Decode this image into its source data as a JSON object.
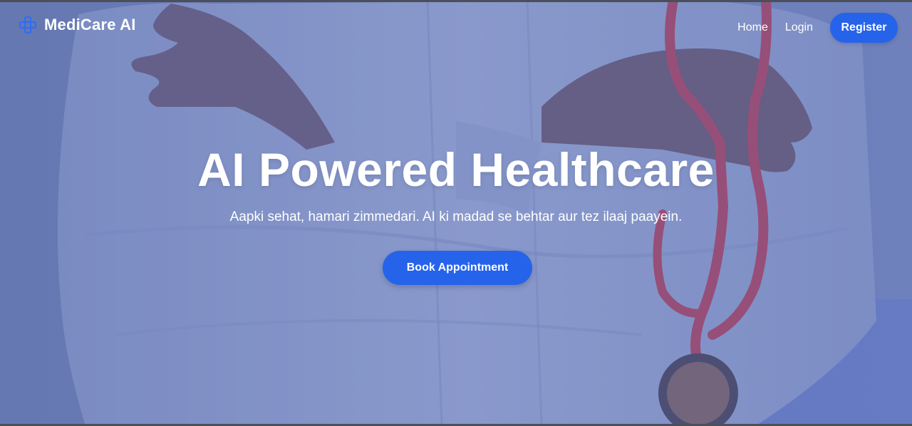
{
  "brand": {
    "name": "MediCare AI",
    "icon": "medical-cross-icon",
    "icon_color": "#2f6df2"
  },
  "nav": {
    "home_label": "Home",
    "login_label": "Login",
    "register_label": "Register"
  },
  "hero": {
    "title": "AI Powered Healthcare",
    "subtitle": "Aapki sehat, hamari zimmedari. AI ki madad se behtar aur tez ilaaj paayein.",
    "cta_label": "Book Appointment"
  },
  "colors": {
    "accent": "#2563eb",
    "overlay": "#7386bd",
    "text": "#ffffff"
  }
}
